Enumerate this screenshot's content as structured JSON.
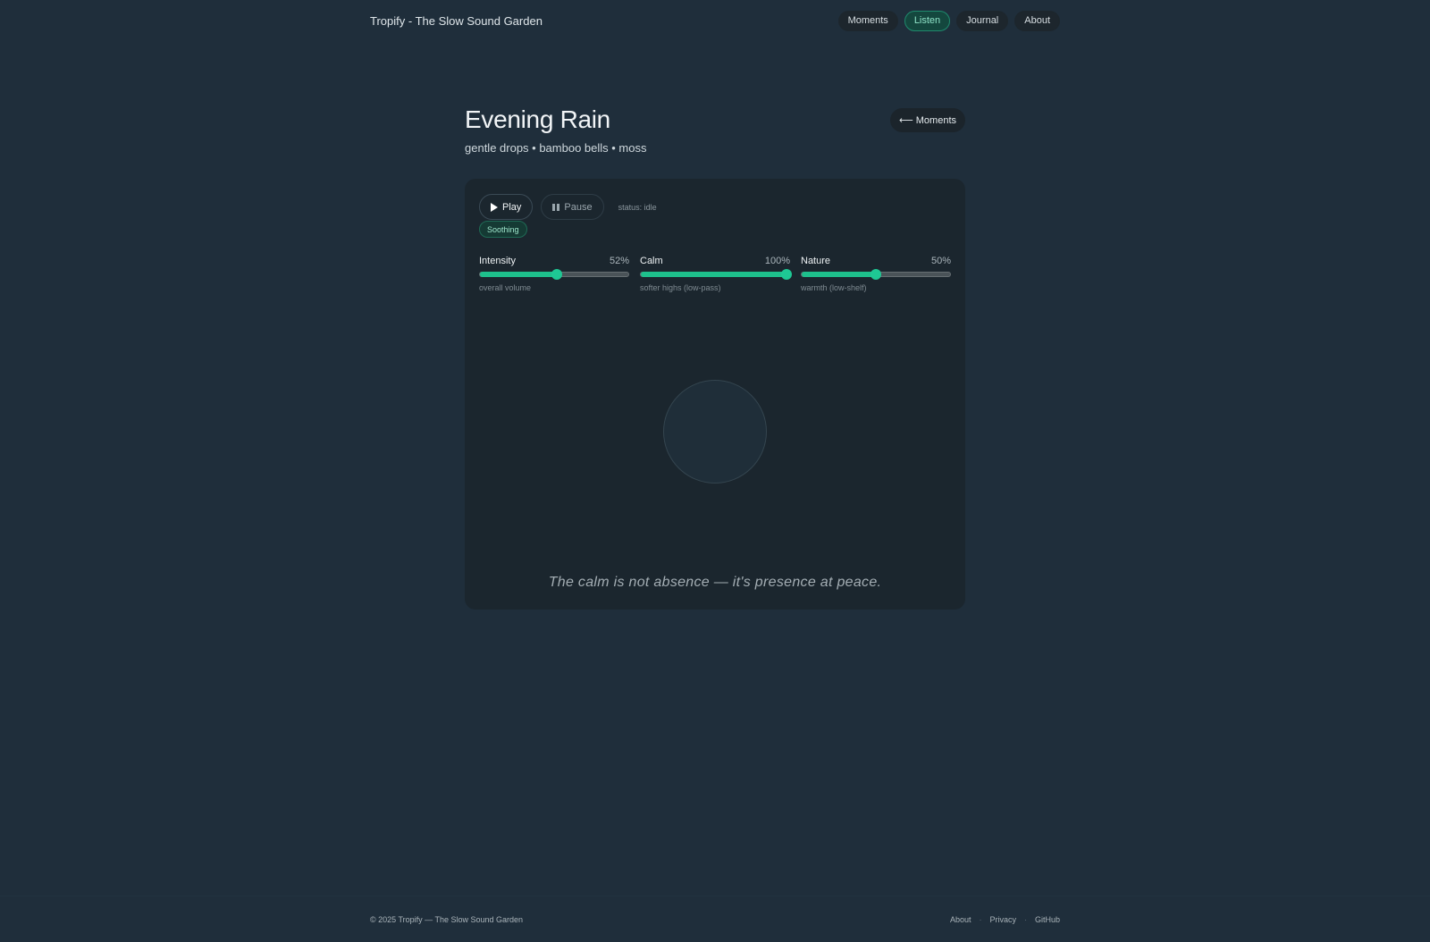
{
  "app": {
    "title": "Tropify - The Slow Sound Garden"
  },
  "nav": {
    "items": [
      {
        "label": "Moments",
        "active": false
      },
      {
        "label": "Listen",
        "active": true
      },
      {
        "label": "Journal",
        "active": false
      },
      {
        "label": "About",
        "active": false
      }
    ]
  },
  "track": {
    "title": "Evening Rain",
    "subtitle": "gentle drops • bamboo bells • moss",
    "back_label": "⟵ Moments"
  },
  "player": {
    "play_label": "Play",
    "pause_label": "Pause",
    "status": "status: idle",
    "badge": "Soothing"
  },
  "sliders": [
    {
      "name": "Intensity",
      "value_label": "52%",
      "value": 52,
      "note": "overall volume"
    },
    {
      "name": "Calm",
      "value_label": "100%",
      "value": 100,
      "note": "softer highs (low-pass)"
    },
    {
      "name": "Nature",
      "value_label": "50%",
      "value": 50,
      "note": "warmth (low-shelf)"
    }
  ],
  "quote": "The calm is not absence — it's presence at peace.",
  "footer": {
    "copyright": "© 2025 Tropify — The Slow Sound Garden",
    "links": [
      "About",
      "Privacy",
      "GitHub"
    ],
    "separator": "·"
  },
  "colors": {
    "background": "#1f2e3b",
    "card": "#1b262e",
    "accent": "#1ec08c",
    "active_nav": "#14473e"
  }
}
